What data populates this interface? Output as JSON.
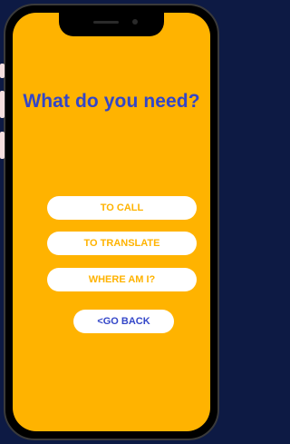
{
  "screen": {
    "title": "What do you need?",
    "buttons": [
      {
        "label": "TO CALL"
      },
      {
        "label": "TO TRANSLATE"
      },
      {
        "label": "WHERE AM I?"
      }
    ],
    "back_label": "<GO BACK"
  },
  "colors": {
    "background": "#0d1a44",
    "screen": "#ffb300",
    "title": "#3346c8",
    "button_bg": "#ffffff",
    "button_text": "#ffb300",
    "back_text": "#3346c8"
  }
}
